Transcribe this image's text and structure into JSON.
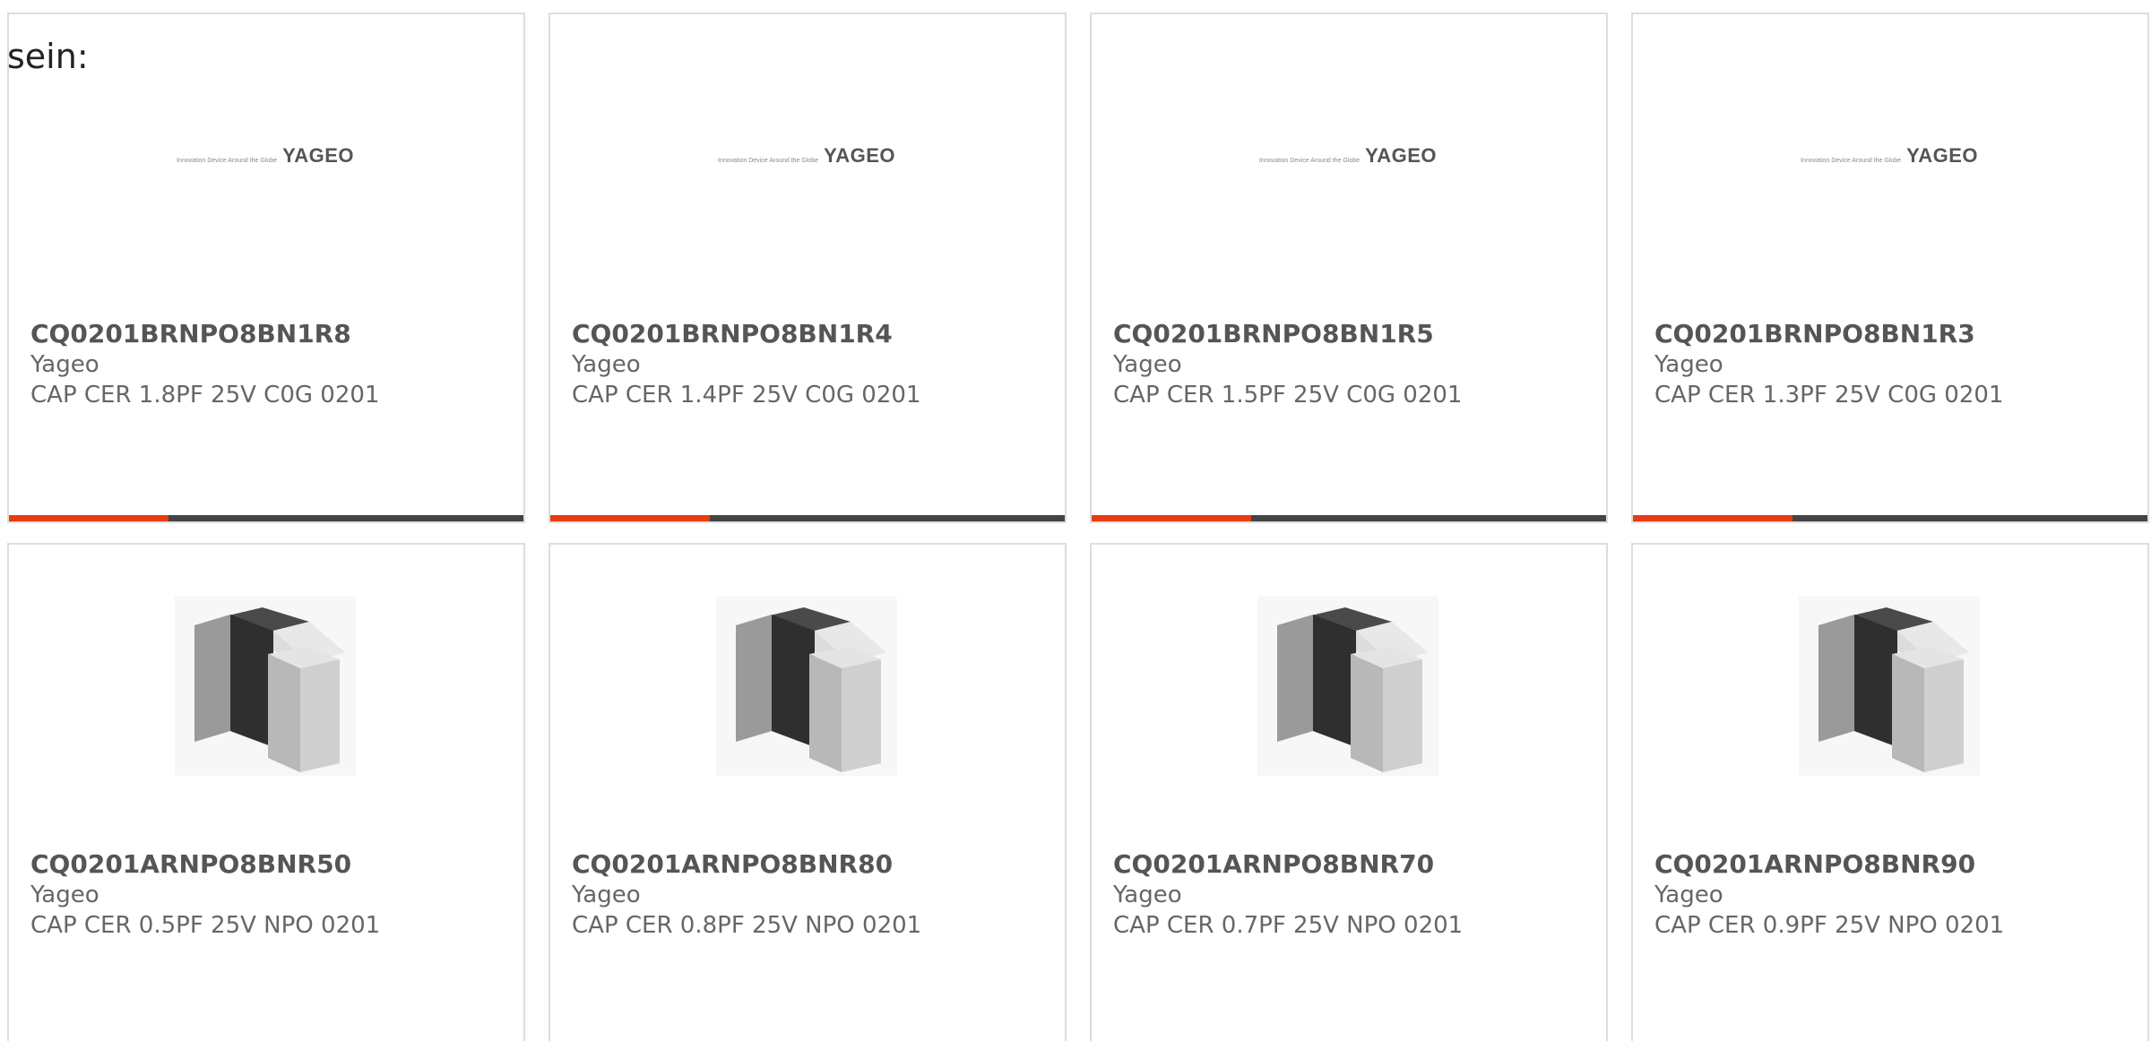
{
  "intro_text": "sein:",
  "colors": {
    "accent": "#e63c12",
    "track": "#444444",
    "border": "#dddddd",
    "text_bold": "#555555",
    "text_muted": "#666666"
  },
  "logo": {
    "tagline": "Innovation Device Around the Globe",
    "wordmark": "YAGEO"
  },
  "products_row1": [
    {
      "part": "CQ0201BRNPO8BN1R8",
      "manufacturer": "Yageo",
      "description": "CAP CER 1.8PF 25V C0G 0201",
      "image": "yageo-logo",
      "progress_fraction": 0.31
    },
    {
      "part": "CQ0201BRNPO8BN1R4",
      "manufacturer": "Yageo",
      "description": "CAP CER 1.4PF 25V C0G 0201",
      "image": "yageo-logo",
      "progress_fraction": 0.31
    },
    {
      "part": "CQ0201BRNPO8BN1R5",
      "manufacturer": "Yageo",
      "description": "CAP CER 1.5PF 25V C0G 0201",
      "image": "yageo-logo",
      "progress_fraction": 0.31
    },
    {
      "part": "CQ0201BRNPO8BN1R3",
      "manufacturer": "Yageo",
      "description": "CAP CER 1.3PF 25V C0G 0201",
      "image": "yageo-logo",
      "progress_fraction": 0.31
    }
  ],
  "products_row2": [
    {
      "part": "CQ0201ARNPO8BNR50",
      "manufacturer": "Yageo",
      "description": "CAP CER 0.5PF 25V NPO 0201",
      "image": "capacitor-chip-photo"
    },
    {
      "part": "CQ0201ARNPO8BNR80",
      "manufacturer": "Yageo",
      "description": "CAP CER 0.8PF 25V NPO 0201",
      "image": "capacitor-chip-photo"
    },
    {
      "part": "CQ0201ARNPO8BNR70",
      "manufacturer": "Yageo",
      "description": "CAP CER 0.7PF 25V NPO 0201",
      "image": "capacitor-chip-photo"
    },
    {
      "part": "CQ0201ARNPO8BNR90",
      "manufacturer": "Yageo",
      "description": "CAP CER 0.9PF 25V NPO 0201",
      "image": "capacitor-chip-photo"
    }
  ]
}
